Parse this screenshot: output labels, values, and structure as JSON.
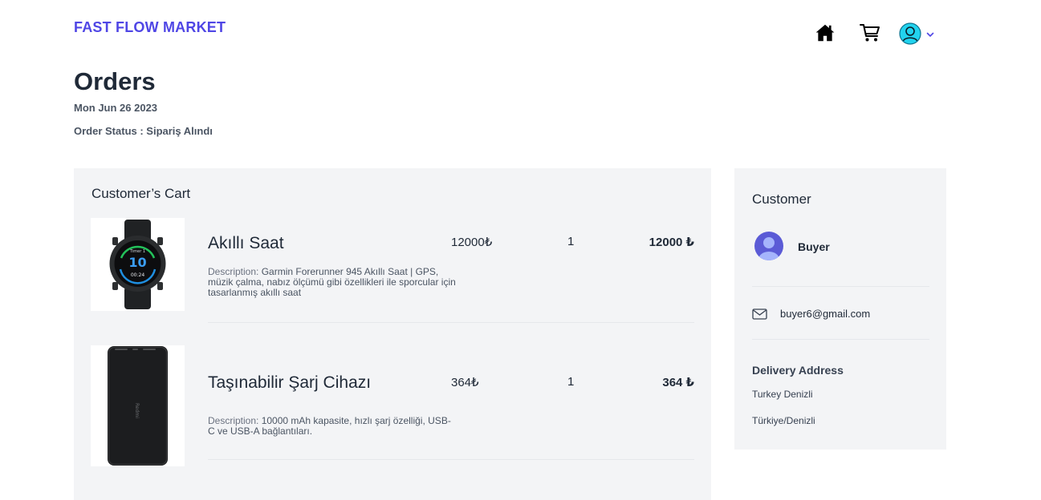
{
  "header": {
    "brand": "FAST FLOW MARKET",
    "icons": [
      "home-icon",
      "cart-icon",
      "user-avatar-icon",
      "chevron-down-icon"
    ]
  },
  "order": {
    "title": "Orders",
    "date": "Mon Jun 26 2023",
    "status": "Order Status : Sipariş Alındı"
  },
  "cart": {
    "title": "Customer’s Cart",
    "items": [
      {
        "name": "Akıllı Saat",
        "price": "12000₺",
        "quantity": "1",
        "total": "12000 ₺",
        "desc_label": "Description:",
        "description": "Garmin Forerunner 945 Akıllı Saat | GPS, müzik çalma, nabız ölçümü gibi özellikleri ile sporcular için tasarlanmış akıllı saat",
        "watch_face": {
          "top": "Timer 1",
          "number": "10",
          "time": "00:24"
        }
      },
      {
        "name": "Taşınabilir Şarj Cihazı",
        "price": "364₺",
        "quantity": "1",
        "total": "364 ₺",
        "desc_label": "Description:",
        "description": "10000 mAh kapasite, hızlı şarj özelliği, USB-C ve USB-A bağlantıları.",
        "device_brand": "Redmi"
      }
    ]
  },
  "customer": {
    "title": "Customer",
    "name": "Buyer",
    "email": "buyer6@gmail.com",
    "address_title": "Delivery Address",
    "address_line1": "Turkey Denizli",
    "address_line2": "Türkiye/Denizli"
  },
  "colors": {
    "brand": "#4f46e5",
    "panel_bg": "#f3f4f6",
    "avatar_teal": "#22d3ee",
    "avatar_indigo": "#4f46e5"
  }
}
